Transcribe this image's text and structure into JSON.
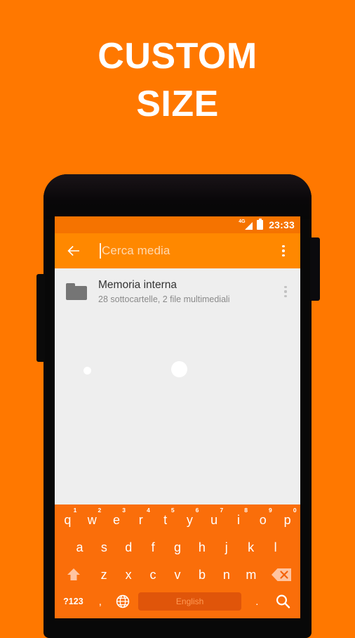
{
  "promo": {
    "line1": "CUSTOM",
    "line2": "SIZE"
  },
  "colors": {
    "background": "#FF7800",
    "toolbar": "#FF8800",
    "statusbar": "#F57300",
    "keyboard": "#FA6E0A",
    "spacebar": "#E0550A",
    "content": "#EEEEEE",
    "folder_icon": "#757575"
  },
  "phone": {
    "camera_icon": "camera-dot",
    "sensor_icon": "sensor-dot",
    "volume_button": "volume-rocker",
    "power_button": "power-button"
  },
  "statusbar": {
    "network": "4G",
    "signal_icon": "signal-bars-icon",
    "battery_icon": "battery-full-icon",
    "time": "23:33"
  },
  "toolbar": {
    "back_icon": "arrow-left-icon",
    "search_placeholder": "Cerca media",
    "search_value": "",
    "overflow_icon": "more-vertical-icon"
  },
  "list": {
    "items": [
      {
        "icon": "folder-icon",
        "title": "Memoria interna",
        "subtitle": "28 sottocartelle, 2 file multimediali",
        "overflow_icon": "more-vertical-icon"
      }
    ]
  },
  "keyboard": {
    "row1": [
      {
        "label": "q",
        "sup": "1"
      },
      {
        "label": "w",
        "sup": "2"
      },
      {
        "label": "e",
        "sup": "3"
      },
      {
        "label": "r",
        "sup": "4"
      },
      {
        "label": "t",
        "sup": "5"
      },
      {
        "label": "y",
        "sup": "6"
      },
      {
        "label": "u",
        "sup": "7"
      },
      {
        "label": "i",
        "sup": "8"
      },
      {
        "label": "o",
        "sup": "9"
      },
      {
        "label": "p",
        "sup": "0"
      }
    ],
    "row2": [
      {
        "label": "a"
      },
      {
        "label": "s"
      },
      {
        "label": "d"
      },
      {
        "label": "f"
      },
      {
        "label": "g"
      },
      {
        "label": "h"
      },
      {
        "label": "j"
      },
      {
        "label": "k"
      },
      {
        "label": "l"
      }
    ],
    "row3": {
      "shift_icon": "shift-arrow-up-icon",
      "letters": [
        {
          "label": "z"
        },
        {
          "label": "x"
        },
        {
          "label": "c"
        },
        {
          "label": "v"
        },
        {
          "label": "b"
        },
        {
          "label": "n"
        },
        {
          "label": "m"
        }
      ],
      "backspace_icon": "backspace-delete-icon"
    },
    "row4": {
      "symbols_label": "?123",
      "comma_label": ",",
      "globe_icon": "language-globe-icon",
      "space_label": "English",
      "period_label": ".",
      "search_icon": "search-magnifier-icon"
    }
  }
}
